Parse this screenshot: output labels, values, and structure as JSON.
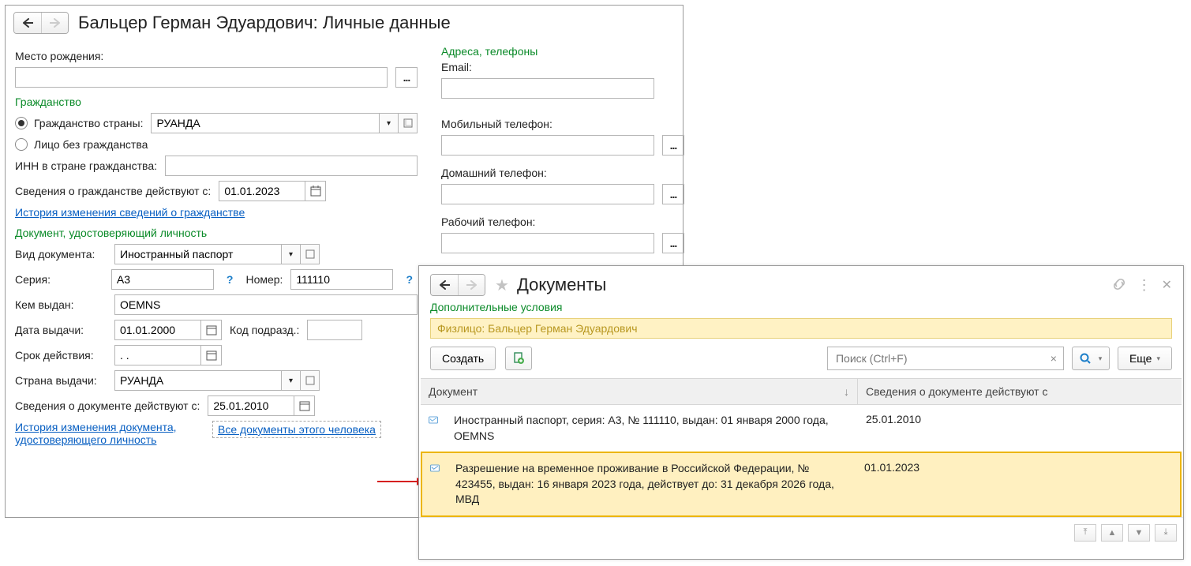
{
  "leftWin": {
    "title": "Бальцер Герман Эдуардович: Личные данные",
    "birthplace_label": "Место рождения:",
    "birthplace": "",
    "citizenship_section": "Гражданство",
    "cit_country_label": "Гражданство страны:",
    "cit_country": "РУАНДА",
    "stateless_label": "Лицо без гражданства",
    "inn_label": "ИНН в стране гражданства:",
    "inn": "",
    "cit_valid_from_label": "Сведения о гражданстве действуют с:",
    "cit_valid_from": "01.01.2023",
    "cit_history_link": "История изменения сведений о гражданстве",
    "doc_section": "Документ, удостоверяющий личность",
    "doc_type_label": "Вид документа:",
    "doc_type": "Иностранный паспорт",
    "series_label": "Серия:",
    "series": "А3",
    "number_label": "Номер:",
    "number": "111110",
    "issued_by_label": "Кем выдан:",
    "issued_by": "OEMNS",
    "issue_date_label": "Дата выдачи:",
    "issue_date": "01.01.2000",
    "subdiv_label": "Код подразд.:",
    "subdiv": "",
    "expiry_label": "Срок действия:",
    "expiry": ". .",
    "issue_country_label": "Страна выдачи:",
    "issue_country": "РУАНДА",
    "doc_valid_from_label": "Сведения о документе действуют с:",
    "doc_valid_from": "25.01.2010",
    "doc_history_link": "История изменения документа, удостоверяющего личность",
    "all_docs_link": "Все документы этого человека",
    "contacts_section": "Адреса, телефоны",
    "email_label": "Email:",
    "email": "",
    "mobile_label": "Мобильный телефон:",
    "mobile": "",
    "home_label": "Домашний телефон:",
    "home": "",
    "work_label": "Рабочий телефон:",
    "work": ""
  },
  "rightWin": {
    "title": "Документы",
    "extra_label": "Дополнительные условия",
    "person_prefix": "Физлицо: ",
    "person_name": "Бальцер Герман Эдуардович",
    "create_btn": "Создать",
    "search_placeholder": "Поиск (Ctrl+F)",
    "more_btn": "Еще",
    "col_doc": "Документ",
    "col_from": "Сведения о документе действуют с",
    "rows": [
      {
        "text": "Иностранный паспорт, серия: А3, № 111110, выдан: 01 января 2000 года, OEMNS",
        "from": "25.01.2010",
        "selected": false
      },
      {
        "text": "Разрешение на временное проживание в Российской Федерации, № 423455, выдан: 16 января 2023 года, действует до: 31 декабря 2026 года, МВД",
        "from": "01.01.2023",
        "selected": true
      }
    ]
  }
}
